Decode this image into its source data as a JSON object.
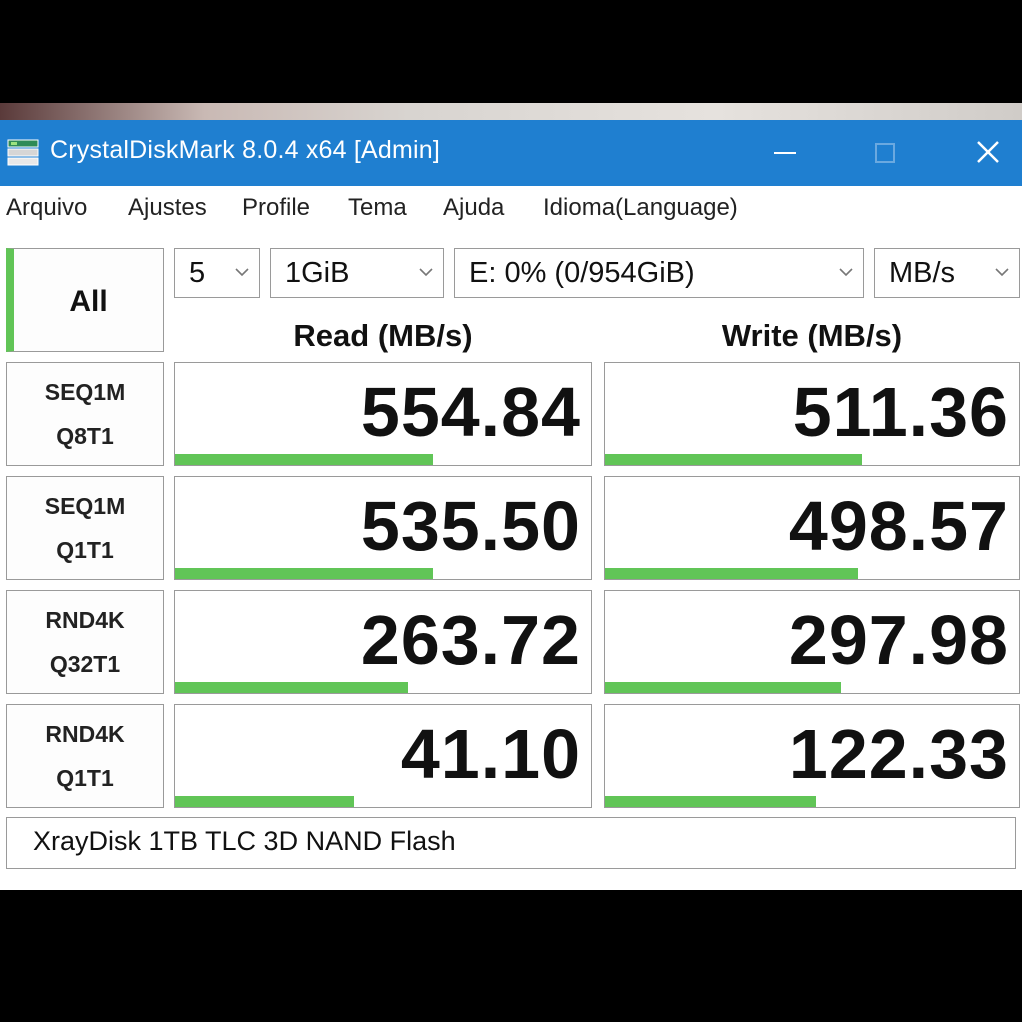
{
  "window": {
    "title": "CrystalDiskMark 8.0.4 x64 [Admin]",
    "title_bar_color": "#1f7fd0"
  },
  "menu": [
    {
      "label": "Arquivo"
    },
    {
      "label": "Ajustes"
    },
    {
      "label": "Profile"
    },
    {
      "label": "Tema"
    },
    {
      "label": "Ajuda"
    },
    {
      "label": "Idioma(Language)"
    }
  ],
  "controls": {
    "all_label": "All",
    "count": "5",
    "size": "1GiB",
    "drive": "E: 0% (0/954GiB)",
    "unit": "MB/s"
  },
  "columns": {
    "read": "Read (MB/s)",
    "write": "Write (MB/s)"
  },
  "rows": [
    {
      "line1": "SEQ1M",
      "line2": "Q8T1",
      "read": "554.84",
      "write": "511.36",
      "read_bar_fraction": 0.62,
      "write_bar_fraction": 0.62
    },
    {
      "line1": "SEQ1M",
      "line2": "Q1T1",
      "read": "535.50",
      "write": "498.57",
      "read_bar_fraction": 0.62,
      "write_bar_fraction": 0.61
    },
    {
      "line1": "RND4K",
      "line2": "Q32T1",
      "read": "263.72",
      "write": "297.98",
      "read_bar_fraction": 0.56,
      "write_bar_fraction": 0.57
    },
    {
      "line1": "RND4K",
      "line2": "Q1T1",
      "read": "41.10",
      "write": "122.33",
      "read_bar_fraction": 0.43,
      "write_bar_fraction": 0.51
    }
  ],
  "comment": "XrayDisk 1TB TLC 3D NAND Flash",
  "colors": {
    "bar": "#61c557",
    "border": "#9a9a9a",
    "accent": "#61c557"
  },
  "icons": {
    "app": "crystaldiskmark-icon",
    "minimize": "minimize-icon",
    "maximize": "maximize-icon",
    "close": "close-icon",
    "dropdown": "chevron-down-icon"
  }
}
